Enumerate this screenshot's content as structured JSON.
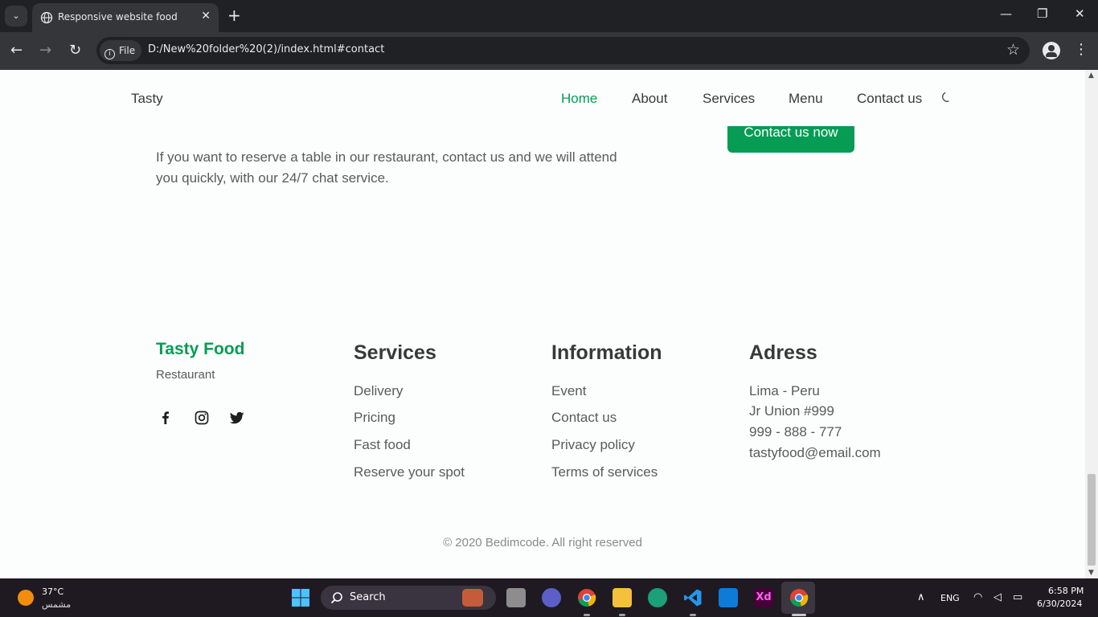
{
  "browser": {
    "tab_title": "Responsive website food",
    "url_chip": "File",
    "url": "D:/New%20folder%20(2)/index.html#contact"
  },
  "nav": {
    "logo": "Tasty",
    "items": [
      "Home",
      "About",
      "Services",
      "Menu",
      "Contact us"
    ],
    "active_item": "Home"
  },
  "contact": {
    "description": "If you want to reserve a table in our restaurant, contact us and we will attend you quickly, with our 24/7 chat service.",
    "button_label": "Contact us now"
  },
  "footer": {
    "brand_title": "Tasty Food",
    "brand_subtitle": "Restaurant",
    "social_icons": [
      "facebook-icon",
      "instagram-icon",
      "twitter-icon"
    ],
    "columns": [
      {
        "title": "Services",
        "links": [
          "Delivery",
          "Pricing",
          "Fast food",
          "Reserve your spot"
        ]
      },
      {
        "title": "Information",
        "links": [
          "Event",
          "Contact us",
          "Privacy policy",
          "Terms of services"
        ]
      },
      {
        "title": "Adress",
        "links": [
          "Lima - Peru",
          "Jr Union #999",
          "999 - 888 - 777",
          "tastyfood@email.com"
        ]
      }
    ],
    "copyright": "© 2020 Bedimcode. All right reserved"
  },
  "taskbar": {
    "weather_temp": "37°C",
    "weather_condition": "مشمس",
    "search_label": "Search",
    "language": "ENG",
    "time": "6:58 PM",
    "date": "6/30/2024"
  },
  "colors": {
    "accent_green": "#069c54",
    "text_dark": "#393939",
    "text_body": "#5a5a5a",
    "page_bg": "#fbfefd"
  }
}
